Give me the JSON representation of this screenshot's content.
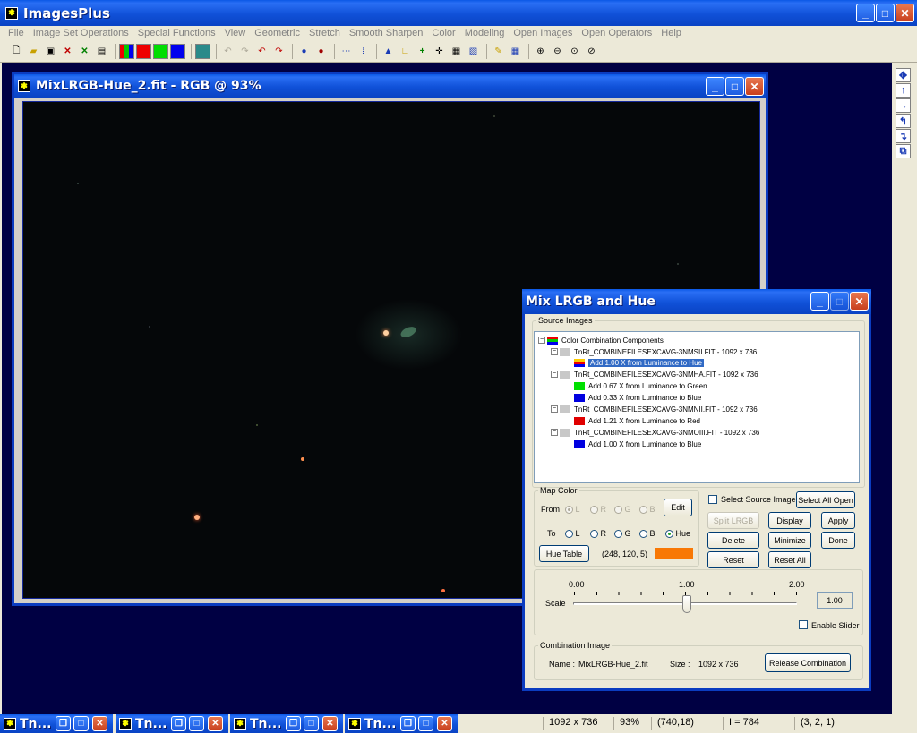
{
  "app": {
    "title": "ImagesPlus",
    "menu": [
      "File",
      "Image Set Operations",
      "Special Functions",
      "View",
      "Geometric",
      "Stretch",
      "Smooth Sharpen",
      "Color",
      "Modeling",
      "Open Images",
      "Open Operators",
      "Help"
    ]
  },
  "image_window": {
    "title": "MixLRGB-Hue_2.fit - RGB @ 93%"
  },
  "dialog": {
    "title": "Mix LRGB and Hue",
    "source_images_label": "Source Images",
    "tree": {
      "root": "Color Combination Components",
      "items": [
        {
          "file": "TnRt_COMBINEFILESEXCAVG-3NMSII.FIT - 1092 x 736",
          "children": [
            {
              "text": "Add 1.00 X from Luminance to Hue",
              "color": "#ffcc00",
              "selected": true
            }
          ]
        },
        {
          "file": "TnRt_COMBINEFILESEXCAVG-3NMHA.FIT - 1092 x 736",
          "children": [
            {
              "text": "Add 0.67 X from Luminance to Green",
              "color": "#00e000"
            },
            {
              "text": "Add 0.33 X from Luminance to Blue",
              "color": "#0000e0"
            }
          ]
        },
        {
          "file": "TnRt_COMBINEFILESEXCAVG-3NMNII.FIT - 1092 x 736",
          "children": [
            {
              "text": "Add 1.21 X from Luminance to Red",
              "color": "#e00000"
            }
          ]
        },
        {
          "file": "TnRt_COMBINEFILESEXCAVG-3NMOIII.FIT - 1092 x 736",
          "children": [
            {
              "text": "Add 1.00 X from Luminance to Blue",
              "color": "#0000e0"
            }
          ]
        }
      ]
    },
    "map_color": {
      "label": "Map Color",
      "from_label": "From",
      "to_label": "To",
      "from_options": [
        "L",
        "R",
        "G",
        "B"
      ],
      "to_options": [
        "L",
        "R",
        "G",
        "B",
        "Hue"
      ],
      "from_selected": "L",
      "to_selected": "Hue",
      "edit_label": "Edit",
      "hue_table_label": "Hue Table",
      "rgb_value": "(248, 120, 5)",
      "swatch_color": "#f87805"
    },
    "select_source_image_label": "Select Source Image",
    "buttons": {
      "select_all_open": "Select All Open",
      "split_lrgb": "Split LRGB",
      "display": "Display",
      "apply": "Apply",
      "delete": "Delete",
      "minimize": "Minimize",
      "done": "Done",
      "reset": "Reset",
      "reset_all": "Reset All",
      "release_combination": "Release Combination"
    },
    "scale": {
      "label": "Scale",
      "min": "0.00",
      "mid": "1.00",
      "max": "2.00",
      "value": "1.00",
      "enable_slider_label": "Enable Slider"
    },
    "combination": {
      "label": "Combination Image",
      "name_label": "Name :",
      "name_value": "MixLRGB-Hue_2.fit",
      "size_label": "Size :",
      "size_value": "1092 x 736"
    }
  },
  "taskbar": {
    "tasks": [
      "Tn...",
      "Tn...",
      "Tn...",
      "Tn..."
    ]
  },
  "status": {
    "dimensions": "1092 x 736",
    "zoom": "93%",
    "cursor": "(740,18)",
    "intensity": "I = 784",
    "rgb": "(3, 2, 1)"
  }
}
